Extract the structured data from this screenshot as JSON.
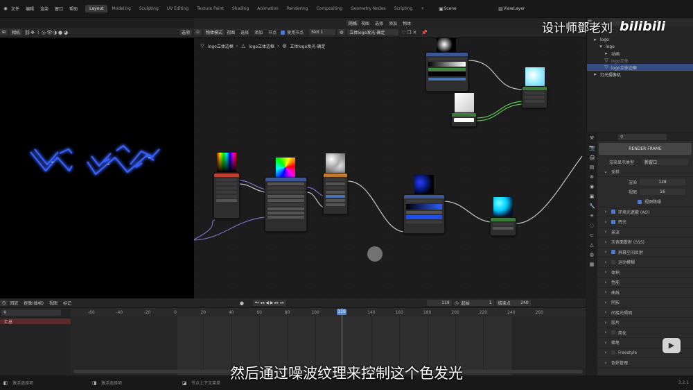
{
  "topbar": {
    "menus": [
      "文件",
      "编辑",
      "渲染",
      "窗口",
      "帮助"
    ],
    "workspaces": [
      "Layout",
      "Modeling",
      "Sculpting",
      "UV Editing",
      "Texture Paint",
      "Shading",
      "Animation",
      "Rendering",
      "Compositing",
      "Geometry Nodes",
      "Scripting",
      "+"
    ],
    "active_workspace": "Layout",
    "scene": "Scene",
    "view_layer": "ViewLayer"
  },
  "watermark": {
    "text": "设计师鄧老刘",
    "brand": "bilibili"
  },
  "viewport_header": {
    "mode": "相机",
    "select": "选项"
  },
  "node_header": {
    "mode": "物体模式",
    "menus": [
      "视图",
      "选择",
      "添加",
      "节点"
    ],
    "use_nodes_label": "使用节点",
    "slot": "Slot 1",
    "object": "网格",
    "object_menus": [
      "视图",
      "选择",
      "添加",
      "物体"
    ],
    "material": "立体logo发光-确定"
  },
  "breadcrumb": [
    "logo立体边框",
    "logo立体边框",
    "立体logo发光-确定"
  ],
  "outliner": {
    "rows": [
      {
        "label": "logo",
        "indent": 1
      },
      {
        "label": "logo",
        "indent": 2
      },
      {
        "label": "动画",
        "indent": 3
      },
      {
        "label": "logo立体",
        "indent": 3
      },
      {
        "label": "logo立体边框",
        "indent": 3,
        "selected": true
      },
      {
        "label": "灯光摄像机",
        "indent": 1
      }
    ]
  },
  "properties": {
    "tab_title": "RENDER FRAME",
    "render_label": "渲染显示类型",
    "render_value": "新窗口",
    "sampling": "采样",
    "render_samples_label": "渲染",
    "render_samples": "128",
    "viewport_samples_label": "视图",
    "viewport_samples": "16",
    "denoise": "视图降噪",
    "sections": [
      {
        "label": "环境光遮蔽 (AO)",
        "check": true
      },
      {
        "label": "辉光",
        "check": true
      },
      {
        "label": "景深",
        "check": null
      },
      {
        "label": "次表面散射 (SSS)",
        "check": null
      },
      {
        "label": "屏幕空间反射",
        "check": true
      },
      {
        "label": "运动模糊",
        "check": false
      },
      {
        "label": "体积",
        "check": null
      },
      {
        "label": "性能",
        "check": null
      },
      {
        "label": "曲线",
        "check": null
      },
      {
        "label": "阴影",
        "check": null
      },
      {
        "label": "间接光照明",
        "check": null
      },
      {
        "label": "胶片",
        "check": null
      },
      {
        "label": "简化",
        "check": false
      },
      {
        "label": "蜡笔",
        "check": null
      },
      {
        "label": "Freestyle",
        "check": false
      },
      {
        "label": "色彩管理",
        "check": null
      }
    ]
  },
  "timeline": {
    "menus": [
      "回放",
      "抠像(插帧)",
      "视图",
      "标记"
    ],
    "current_frame": "119",
    "start_label": "起始",
    "start": "1",
    "end_label": "结束点",
    "end": "240",
    "ticks": [
      "-60",
      "-40",
      "-20",
      "0",
      "20",
      "40",
      "60",
      "80",
      "100",
      "119",
      "140",
      "160",
      "180",
      "200",
      "220",
      "240",
      "260"
    ],
    "summary": "汇总"
  },
  "status": {
    "left": "激活选择项",
    "mid": "激活选择项",
    "right": "节点上下文菜单",
    "version": "3.2.1"
  },
  "subtitle": "然后通过噪波纹理来控制这个色发光",
  "colors": {
    "accent": "#4772b3",
    "playhead": "#4f8bd6",
    "glow": "#2f5dff"
  }
}
